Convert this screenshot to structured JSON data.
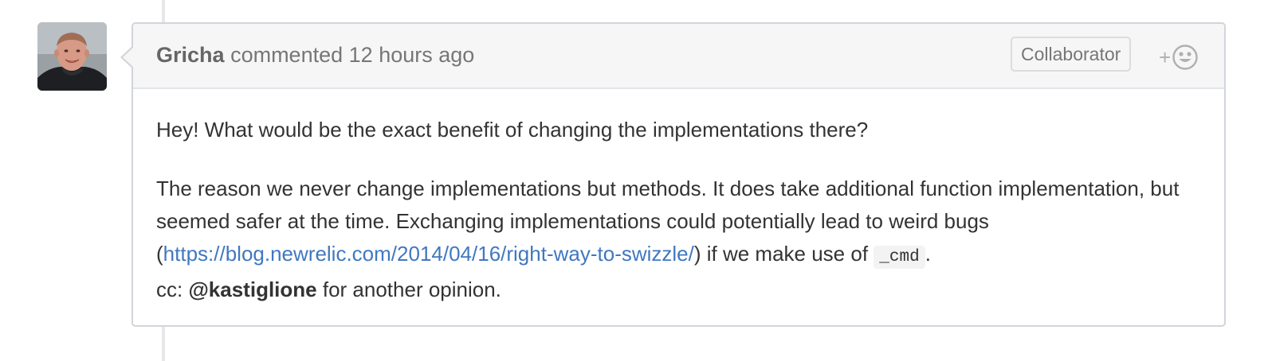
{
  "comment": {
    "author": "Gricha",
    "action": "commented",
    "timestamp": "12 hours ago",
    "badge": "Collaborator",
    "reaction": {
      "plus": "+",
      "icon": "smiley-icon"
    },
    "body": {
      "paragraph1": "Hey! What would be the exact benefit of changing the implementations there?",
      "paragraph2_part1": "The reason we never change implementations but methods. It does take additional function implementation, but seemed safer at the time. Exchanging implementations could potentially lead to weird bugs (",
      "link": "https://blog.newrelic.com/2014/04/16/right-way-to-swizzle/",
      "paragraph2_part2": ") if we make use of ",
      "code": "_cmd",
      "paragraph2_part3": ".",
      "cc_prefix": "cc: ",
      "mention": "@kastiglione",
      "cc_suffix": " for another opinion."
    }
  },
  "colors": {
    "link": "#4078c0",
    "border": "#d1d5da",
    "header_bg": "#f6f6f6",
    "timeline": "#e7e7e7"
  }
}
